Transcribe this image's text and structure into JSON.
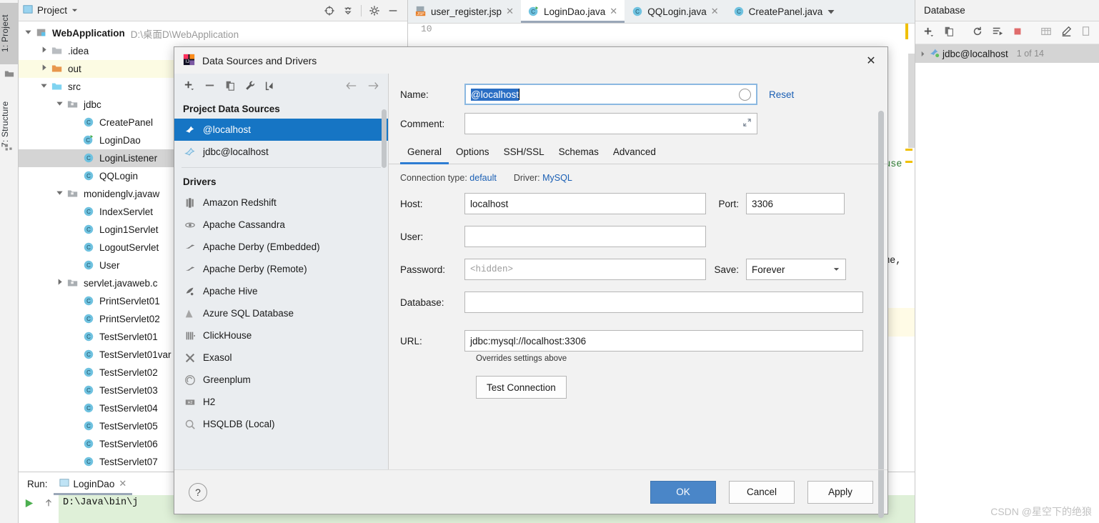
{
  "tool_strip": {
    "tabs": [
      {
        "label": "1: Project",
        "active": true,
        "icon": "folder-icon"
      },
      {
        "label": "7: Structure",
        "active": false,
        "icon": "structure-icon"
      }
    ]
  },
  "project_panel": {
    "title": "Project",
    "toolbar_icons": [
      "locate-target-icon",
      "collapse-all-icon",
      "gear-icon",
      "hide-icon"
    ],
    "tree": [
      {
        "depth": 0,
        "arrow": "down",
        "icon": "module-icon",
        "label": "WebApplication",
        "bold": true,
        "path": "D:\\桌面D\\WebApplication",
        "highlight": "none"
      },
      {
        "depth": 1,
        "arrow": "right",
        "icon": "folder-grey-icon",
        "label": ".idea",
        "bold": false,
        "path": "",
        "highlight": "none"
      },
      {
        "depth": 1,
        "arrow": "right",
        "icon": "folder-orange-icon",
        "label": "out",
        "bold": false,
        "path": "",
        "highlight": "yellow"
      },
      {
        "depth": 1,
        "arrow": "down",
        "icon": "folder-blue-icon",
        "label": "src",
        "bold": false,
        "path": "",
        "highlight": "none"
      },
      {
        "depth": 2,
        "arrow": "down",
        "icon": "package-icon",
        "label": "jdbc",
        "bold": false,
        "path": "",
        "highlight": "none"
      },
      {
        "depth": 3,
        "arrow": "none",
        "icon": "class-icon",
        "label": "CreatePanel",
        "bold": false,
        "path": "",
        "highlight": "none"
      },
      {
        "depth": 3,
        "arrow": "none",
        "icon": "class-run-icon",
        "label": "LoginDao",
        "bold": false,
        "path": "",
        "highlight": "none"
      },
      {
        "depth": 3,
        "arrow": "none",
        "icon": "class-icon",
        "label": "LoginListener",
        "bold": false,
        "path": "",
        "highlight": "grey"
      },
      {
        "depth": 3,
        "arrow": "none",
        "icon": "class-icon",
        "label": "QQLogin",
        "bold": false,
        "path": "",
        "highlight": "none"
      },
      {
        "depth": 2,
        "arrow": "down",
        "icon": "package-icon",
        "label": "monidenglv.javaw",
        "bold": false,
        "path": "",
        "highlight": "none"
      },
      {
        "depth": 3,
        "arrow": "none",
        "icon": "class-icon",
        "label": "IndexServlet",
        "bold": false,
        "path": "",
        "highlight": "none"
      },
      {
        "depth": 3,
        "arrow": "none",
        "icon": "class-icon",
        "label": "Login1Servlet",
        "bold": false,
        "path": "",
        "highlight": "none"
      },
      {
        "depth": 3,
        "arrow": "none",
        "icon": "class-icon",
        "label": "LogoutServlet",
        "bold": false,
        "path": "",
        "highlight": "none"
      },
      {
        "depth": 3,
        "arrow": "none",
        "icon": "class-icon",
        "label": "User",
        "bold": false,
        "path": "",
        "highlight": "none"
      },
      {
        "depth": 2,
        "arrow": "right",
        "icon": "package-icon",
        "label": "servlet.javaweb.c",
        "bold": false,
        "path": "",
        "highlight": "none"
      },
      {
        "depth": 3,
        "arrow": "none",
        "icon": "class-icon",
        "label": "PrintServlet01",
        "bold": false,
        "path": "",
        "highlight": "none"
      },
      {
        "depth": 3,
        "arrow": "none",
        "icon": "class-icon",
        "label": "PrintServlet02",
        "bold": false,
        "path": "",
        "highlight": "none"
      },
      {
        "depth": 3,
        "arrow": "none",
        "icon": "class-icon",
        "label": "TestServlet01",
        "bold": false,
        "path": "",
        "highlight": "none"
      },
      {
        "depth": 3,
        "arrow": "none",
        "icon": "class-icon",
        "label": "TestServlet01var",
        "bold": false,
        "path": "",
        "highlight": "none"
      },
      {
        "depth": 3,
        "arrow": "none",
        "icon": "class-icon",
        "label": "TestServlet02",
        "bold": false,
        "path": "",
        "highlight": "none"
      },
      {
        "depth": 3,
        "arrow": "none",
        "icon": "class-icon",
        "label": "TestServlet03",
        "bold": false,
        "path": "",
        "highlight": "none"
      },
      {
        "depth": 3,
        "arrow": "none",
        "icon": "class-icon",
        "label": "TestServlet04",
        "bold": false,
        "path": "",
        "highlight": "none"
      },
      {
        "depth": 3,
        "arrow": "none",
        "icon": "class-icon",
        "label": "TestServlet05",
        "bold": false,
        "path": "",
        "highlight": "none"
      },
      {
        "depth": 3,
        "arrow": "none",
        "icon": "class-icon",
        "label": "TestServlet06",
        "bold": false,
        "path": "",
        "highlight": "none"
      },
      {
        "depth": 3,
        "arrow": "none",
        "icon": "class-icon",
        "label": "TestServlet07",
        "bold": false,
        "path": "",
        "highlight": "none"
      }
    ]
  },
  "editor": {
    "tabs": [
      {
        "label": "user_register.jsp",
        "icon": "jsp-file-icon",
        "active": false,
        "closable": true
      },
      {
        "label": "LoginDao.java",
        "icon": "class-run-icon",
        "active": true,
        "closable": true
      },
      {
        "label": "QQLogin.java",
        "icon": "class-icon",
        "active": false,
        "closable": true
      },
      {
        "label": "CreatePanel.java",
        "icon": "class-icon",
        "active": false,
        "closable": false
      }
    ],
    "tabs_overflow_icon": "chevron-down-icon",
    "line_number": "10",
    "code_fragments": [
      {
        "text": "?use",
        "color": "#2e7d32"
      },
      {
        "text": "me,",
        "color": "#1a1a1a"
      }
    ]
  },
  "database_panel": {
    "title": "Database",
    "toolbar_icons": [
      "add-icon",
      "copy-icon",
      "refresh-icon",
      "run-sql-icon",
      "stop-icon",
      "table-icon",
      "edit-icon",
      "more-icon"
    ],
    "item": {
      "label": "jdbc@localhost",
      "count": "1 of 14",
      "icon": "mysql-icon",
      "arrow": "right"
    }
  },
  "run_panel": {
    "label": "Run:",
    "tab_label": "LoginDao",
    "tab_icon": "run-config-icon",
    "console_line": "D:\\Java\\bin\\j",
    "rerun_icon": "play-icon",
    "up_icon": "arrow-up-icon"
  },
  "dialog": {
    "title": "Data Sources and Drivers",
    "icon": "intellij-icon",
    "close_icon": "close-icon",
    "left": {
      "toolbar_icons": [
        "add-icon",
        "remove-icon",
        "duplicate-icon",
        "wrench-icon",
        "import-icon"
      ],
      "nav_back_icon": "arrow-left-icon",
      "nav_forward_icon": "arrow-right-icon",
      "data_sources_group": "Project Data Sources",
      "data_sources": [
        {
          "label": "@localhost",
          "icon": "mysql-icon",
          "selected": true
        },
        {
          "label": "jdbc@localhost",
          "icon": "mysql-icon",
          "selected": false
        }
      ],
      "drivers_group": "Drivers",
      "drivers": [
        {
          "label": "Amazon Redshift",
          "icon": "redshift-icon"
        },
        {
          "label": "Apache Cassandra",
          "icon": "cassandra-icon"
        },
        {
          "label": "Apache Derby (Embedded)",
          "icon": "derby-icon"
        },
        {
          "label": "Apache Derby (Remote)",
          "icon": "derby-icon"
        },
        {
          "label": "Apache Hive",
          "icon": "hive-icon"
        },
        {
          "label": "Azure SQL Database",
          "icon": "azure-icon"
        },
        {
          "label": "ClickHouse",
          "icon": "clickhouse-icon"
        },
        {
          "label": "Exasol",
          "icon": "exasol-icon"
        },
        {
          "label": "Greenplum",
          "icon": "greenplum-icon"
        },
        {
          "label": "H2",
          "icon": "h2-icon"
        },
        {
          "label": "HSQLDB (Local)",
          "icon": "hsqldb-icon"
        }
      ]
    },
    "right": {
      "name_label": "Name:",
      "name_value": "@localhost",
      "comment_label": "Comment:",
      "comment_value": "",
      "reset_label": "Reset",
      "tabs": [
        {
          "label": "General",
          "active": true
        },
        {
          "label": "Options",
          "active": false
        },
        {
          "label": "SSH/SSL",
          "active": false
        },
        {
          "label": "Schemas",
          "active": false
        },
        {
          "label": "Advanced",
          "active": false
        }
      ],
      "connection_type_label": "Connection type:",
      "connection_type_value": "default",
      "driver_label": "Driver:",
      "driver_value": "MySQL",
      "host_label": "Host:",
      "host_value": "localhost",
      "port_label": "Port:",
      "port_value": "3306",
      "user_label": "User:",
      "user_value": "",
      "password_label": "Password:",
      "password_placeholder": "<hidden>",
      "save_label": "Save:",
      "save_value": "Forever",
      "database_label": "Database:",
      "database_value": "",
      "url_label": "URL:",
      "url_value": "jdbc:mysql://localhost:3306",
      "url_hint": "Overrides settings above",
      "test_connection_label": "Test Connection"
    },
    "footer": {
      "help_label": "?",
      "ok_label": "OK",
      "cancel_label": "Cancel",
      "apply_label": "Apply"
    }
  },
  "watermark": "CSDN @星空下的绝狼",
  "colors": {
    "accent_blue": "#1675c4",
    "tab_underline": "#2d7dd2",
    "link": "#1a5fb4",
    "ok_button": "#4a86c8",
    "class_icon": "#6fc2e0",
    "folder_orange": "#e8974c",
    "console_green": "#dff0d8"
  }
}
